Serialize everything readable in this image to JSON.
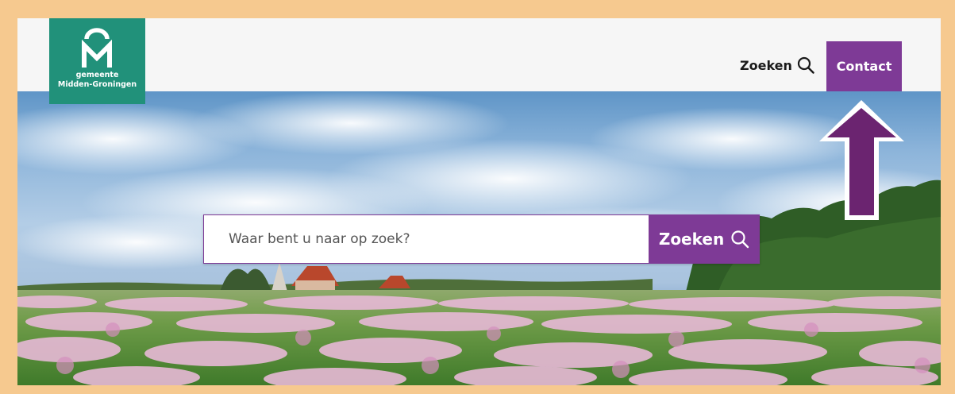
{
  "logo": {
    "line1": "gemeente",
    "line2": "Midden-Groningen",
    "letter": "M"
  },
  "header": {
    "search_label": "Zoeken",
    "contact_label": "Contact"
  },
  "hero": {
    "search_placeholder": "Waar bent u naar op zoek?",
    "search_button_label": "Zoeken"
  },
  "colors": {
    "brand_green": "#21917a",
    "accent_purple": "#7e3a96",
    "arrow_purple": "#6b2470",
    "frame_border": "#f6c98f"
  },
  "icons": [
    "search-icon",
    "arrow-up-icon"
  ]
}
